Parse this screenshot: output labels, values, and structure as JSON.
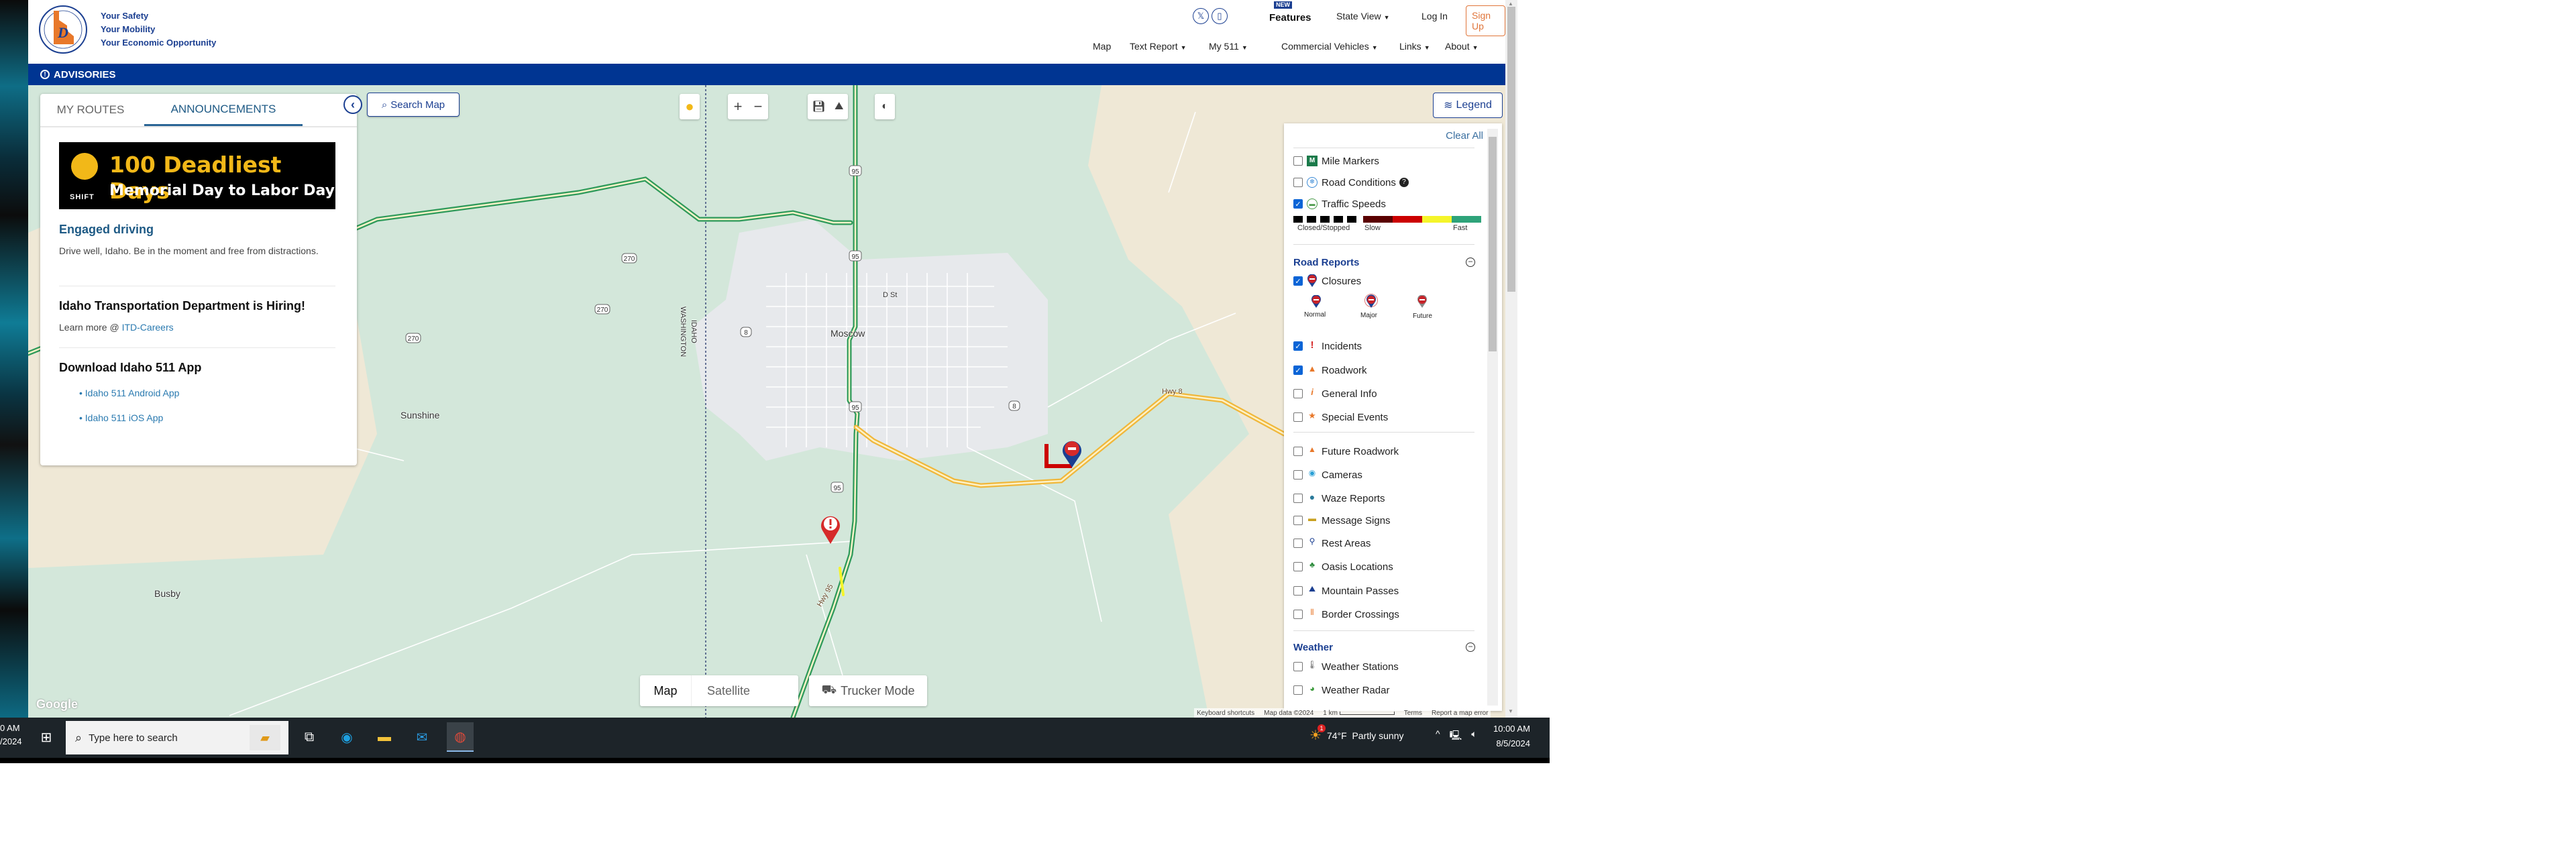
{
  "header": {
    "taglines": [
      "Your Safety",
      "Your Mobility",
      "Your Economic Opportunity"
    ],
    "logo_alt": "Idaho Transportation Department",
    "top_links": {
      "new_badge": "NEW",
      "features": "Features",
      "state_view": "State View",
      "log_in": "Log In",
      "sign_up": "Sign Up"
    },
    "nav": [
      "Map",
      "Text Report",
      "My 511",
      "Commercial Vehicles",
      "Links",
      "About"
    ],
    "nav_has_dropdown": [
      false,
      true,
      true,
      true,
      true,
      true
    ],
    "advisories": "ADVISORIES"
  },
  "side_panel": {
    "tabs": [
      {
        "label": "MY ROUTES",
        "active": false
      },
      {
        "label": "ANNOUNCEMENTS",
        "active": true
      }
    ],
    "banner": {
      "line1": "100 Deadliest Days",
      "line2": "Memorial Day to Labor Day",
      "brand": "SHIFT"
    },
    "announcements": [
      {
        "title": "Engaged driving",
        "body": "Drive well, Idaho. Be in the moment and free from distractions."
      },
      {
        "title": "Idaho Transportation Department is Hiring!",
        "body_prefix": "Learn more @ ",
        "link": "ITD-Careers"
      },
      {
        "title": "Download Idaho 511 App",
        "links": [
          "Idaho 511 Android App",
          "Idaho 511 iOS App"
        ]
      }
    ]
  },
  "map_controls": {
    "search_map": "Search Map",
    "legend": "Legend",
    "map_type": [
      "Map",
      "Satellite"
    ],
    "map_type_active": "Map",
    "trucker_mode": "Trucker Mode",
    "attribution": [
      "Keyboard shortcuts",
      "Map data ©2024",
      "1 km",
      "Terms",
      "Report a map error"
    ],
    "google": "Google"
  },
  "map_labels": {
    "towns": [
      "Moscow",
      "Sunshine",
      "Busby"
    ],
    "streets": [
      "D St",
      "Hwy 8",
      "Hwy 95"
    ],
    "state_line": [
      "IDAHO",
      "WASHINGTON"
    ],
    "shields": [
      "95",
      "95",
      "95",
      "95",
      "8",
      "8",
      "270",
      "270",
      "270"
    ]
  },
  "legend": {
    "clear_all": "Clear All",
    "top_items": [
      {
        "label": "Mile Markers",
        "checked": false,
        "icon": "mile-marker-icon"
      },
      {
        "label": "Road Conditions",
        "checked": false,
        "icon": "snowflake-icon",
        "help": true
      },
      {
        "label": "Traffic Speeds",
        "checked": true,
        "icon": "car-icon"
      }
    ],
    "speed_scale": {
      "closed": "Closed/Stopped",
      "slow": "Slow",
      "fast": "Fast",
      "colors": [
        "#000000",
        "#5a0000",
        "#cc0000",
        "#f5f52a",
        "#2ea37a"
      ]
    },
    "road_reports_title": "Road Reports",
    "closures": {
      "label": "Closures",
      "checked": true,
      "sub": [
        "Normal",
        "Major",
        "Future"
      ]
    },
    "road_items": [
      {
        "label": "Incidents",
        "checked": true,
        "icon": "incident-icon"
      },
      {
        "label": "Roadwork",
        "checked": true,
        "icon": "roadwork-icon"
      },
      {
        "label": "General Info",
        "checked": false,
        "icon": "info-icon"
      },
      {
        "label": "Special Events",
        "checked": false,
        "icon": "star-icon"
      }
    ],
    "other_items": [
      {
        "label": "Future Roadwork",
        "checked": false,
        "icon": "future-roadwork-icon"
      },
      {
        "label": "Cameras",
        "checked": false,
        "icon": "camera-icon"
      },
      {
        "label": "Waze Reports",
        "checked": false,
        "icon": "waze-icon"
      },
      {
        "label": "Message Signs",
        "checked": false,
        "icon": "message-sign-icon"
      },
      {
        "label": "Rest Areas",
        "checked": false,
        "icon": "rest-area-icon"
      },
      {
        "label": "Oasis Locations",
        "checked": false,
        "icon": "oasis-icon"
      },
      {
        "label": "Mountain Passes",
        "checked": false,
        "icon": "mountain-icon"
      },
      {
        "label": "Border Crossings",
        "checked": false,
        "icon": "border-crossing-icon"
      }
    ],
    "weather_title": "Weather",
    "weather_items": [
      {
        "label": "Weather Stations",
        "checked": false,
        "icon": "thermometer-icon"
      },
      {
        "label": "Weather Radar",
        "checked": false,
        "icon": "radar-icon"
      }
    ]
  },
  "taskbar": {
    "left_clock": [
      "0 AM",
      "/2024"
    ],
    "search_placeholder": "Type here to search",
    "weather": "74°F  Partly sunny",
    "weather_badge": "1",
    "time": "10:00 AM",
    "date": "8/5/2024"
  }
}
